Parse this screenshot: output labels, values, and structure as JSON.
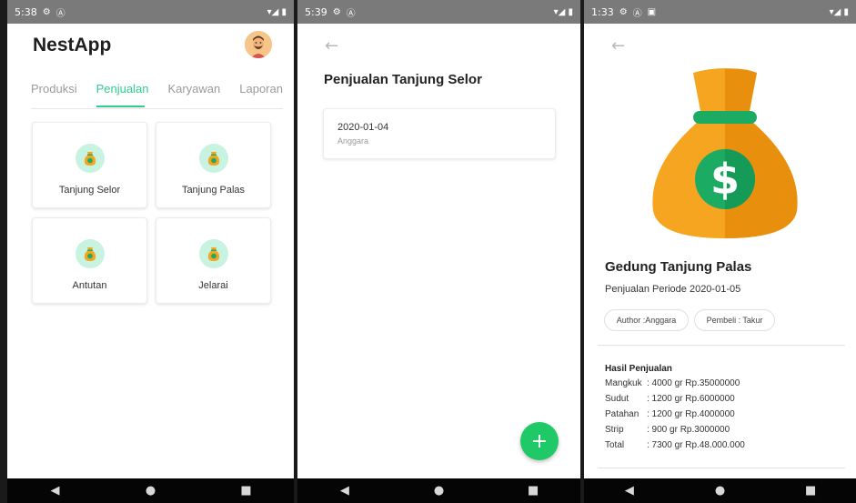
{
  "colors": {
    "accent": "#2fcf8a",
    "fab": "#20c968",
    "status_bar": "#7a7a7a",
    "nav_bar": "#050505",
    "bag_orange": "#f5a51f",
    "bag_dark": "#e8900e",
    "coin_green": "#1bab62"
  },
  "screen1": {
    "status": {
      "time": "5:38"
    },
    "app_title": "NestApp",
    "tabs": [
      "Produksi",
      "Penjualan",
      "Karyawan",
      "Laporan"
    ],
    "active_tab": "Penjualan",
    "locations": [
      "Tanjung Selor",
      "Tanjung Palas",
      "Antutan",
      "Jelarai"
    ]
  },
  "screen2": {
    "status": {
      "time": "5:39"
    },
    "title": "Penjualan Tanjung Selor",
    "item": {
      "date": "2020-01-04",
      "author": "Anggara"
    },
    "fab_label": "+"
  },
  "screen3": {
    "status": {
      "time": "1:33"
    },
    "title": "Gedung Tanjung Palas",
    "subtitle": "Penjualan Periode 2020-01-05",
    "chips": [
      "Author :Anggara",
      "Pembeli : Takur"
    ],
    "result_title": "Hasil Penjualan",
    "results": [
      {
        "k": "Mangkuk",
        "v": ": 4000  gr Rp.35000000"
      },
      {
        "k": "Sudut",
        "v": ": 1200  gr Rp.6000000"
      },
      {
        "k": "Patahan",
        "v": ": 1200  gr Rp.4000000"
      },
      {
        "k": "Strip",
        "v": ": 900   gr Rp.3000000"
      },
      {
        "k": "Total",
        "v": ": 7300 gr Rp.48.000.000"
      }
    ]
  },
  "icons": {
    "back": "←",
    "nav_back": "◀",
    "nav_home": "●",
    "nav_recent": "■",
    "gear": "⚙",
    "wifi": "▾",
    "battery": "▮"
  }
}
